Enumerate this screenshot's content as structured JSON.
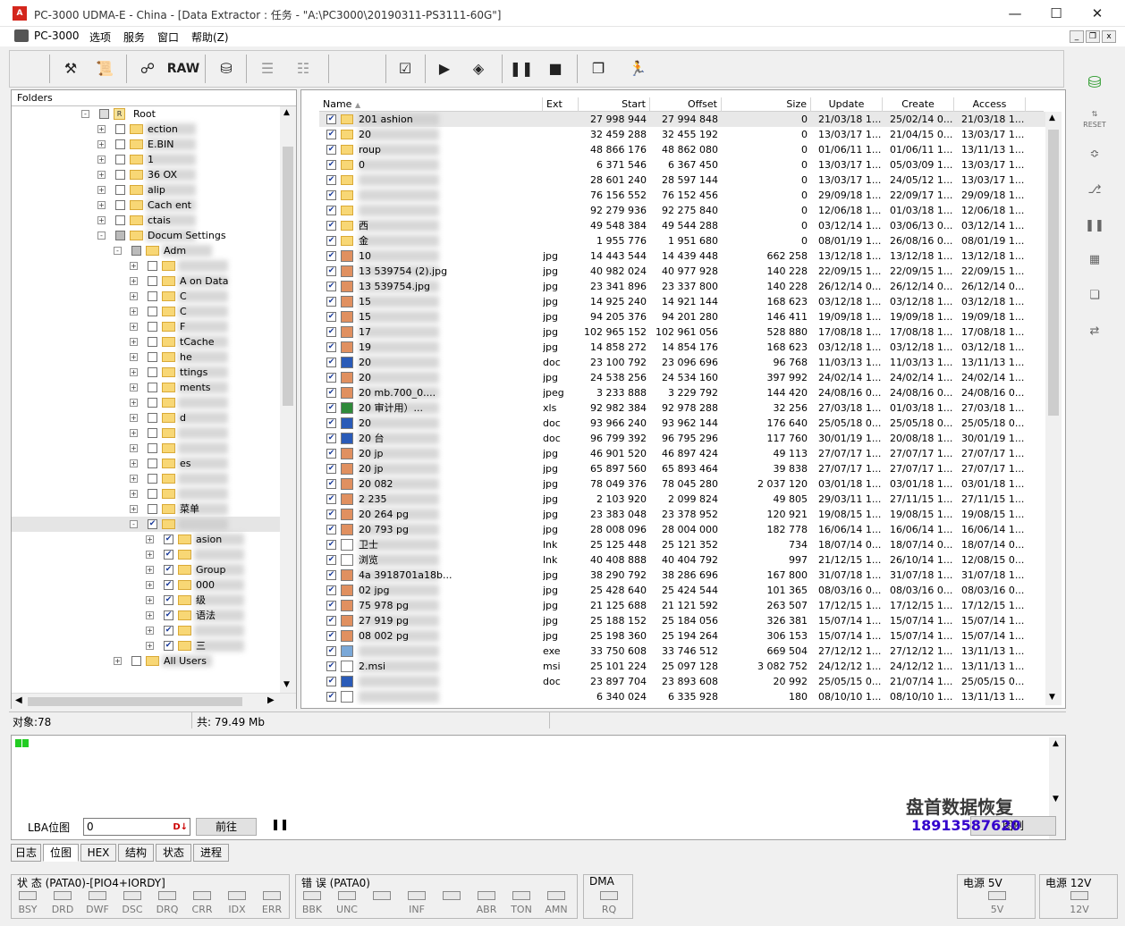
{
  "window": {
    "title": "PC-3000 UDMA-E - China - [Data Extractor : 任务 - \"A:\\PC3000\\20190311-PS3111-60G\"]",
    "app_icon_text": "A"
  },
  "menu": {
    "items": [
      "PC-3000",
      "选项",
      "服务",
      "窗口",
      "帮助(Z)"
    ]
  },
  "toolbar": {
    "raw_label": "RAW"
  },
  "tree": {
    "header": "Folders",
    "root": "Root",
    "rows": [
      {
        "label": "ection",
        "checked": false
      },
      {
        "label": "E.BIN",
        "checked": false
      },
      {
        "label": "1",
        "checked": false
      },
      {
        "label": "36 OX",
        "checked": false
      },
      {
        "label": "alip",
        "checked": false
      },
      {
        "label": "Cach ent",
        "checked": false
      },
      {
        "label": "ctais",
        "checked": false
      },
      {
        "label": "Docum Settings",
        "checked": false
      },
      {
        "label": "Adm",
        "checked": false
      },
      {
        "label": "",
        "checked": false
      },
      {
        "label": "A on Data",
        "checked": false
      },
      {
        "label": "C",
        "checked": false
      },
      {
        "label": "C",
        "checked": false
      },
      {
        "label": "F",
        "checked": false
      },
      {
        "label": "tCache",
        "checked": false
      },
      {
        "label": "he",
        "checked": false
      },
      {
        "label": "ttings",
        "checked": false
      },
      {
        "label": "ments",
        "checked": false
      },
      {
        "label": "",
        "checked": false
      },
      {
        "label": "d",
        "checked": false
      },
      {
        "label": "",
        "checked": false
      },
      {
        "label": "",
        "checked": false
      },
      {
        "label": "es",
        "checked": false
      },
      {
        "label": "",
        "checked": false
      },
      {
        "label": "",
        "checked": false
      },
      {
        "label": "菜单",
        "checked": false
      },
      {
        "label": "",
        "checked": true
      },
      {
        "label": "asion",
        "checked": true
      },
      {
        "label": "",
        "checked": true
      },
      {
        "label": "Group",
        "checked": true
      },
      {
        "label": "000",
        "checked": true
      },
      {
        "label": "级",
        "checked": true
      },
      {
        "label": "语法",
        "checked": true
      },
      {
        "label": "",
        "checked": true
      },
      {
        "label": "三",
        "checked": true
      },
      {
        "label": "All Users",
        "checked": false
      }
    ]
  },
  "files": {
    "columns": [
      "Name",
      "Ext",
      "Start",
      "Offset",
      "Size",
      "Update",
      "Create",
      "Access"
    ],
    "rows": [
      {
        "name": "201 ashion",
        "type": "folder",
        "ext": "",
        "start": "27 998 944",
        "offset": "27 994 848",
        "size": "0",
        "update": "21/03/18 1...",
        "create": "25/02/14 0...",
        "access": "21/03/18 1..."
      },
      {
        "name": "20",
        "type": "folder",
        "ext": "",
        "start": "32 459 288",
        "offset": "32 455 192",
        "size": "0",
        "update": "13/03/17 1...",
        "create": "21/04/15 0...",
        "access": "13/03/17 1..."
      },
      {
        "name": "roup",
        "type": "folder",
        "ext": "",
        "start": "48 866 176",
        "offset": "48 862 080",
        "size": "0",
        "update": "01/06/11 1...",
        "create": "01/06/11 1...",
        "access": "13/11/13 1..."
      },
      {
        "name": "0",
        "type": "folder",
        "ext": "",
        "start": "6 371 546",
        "offset": "6 367 450",
        "size": "0",
        "update": "13/03/17 1...",
        "create": "05/03/09 1...",
        "access": "13/03/17 1..."
      },
      {
        "name": "",
        "type": "folder",
        "ext": "",
        "start": "28 601 240",
        "offset": "28 597 144",
        "size": "0",
        "update": "13/03/17 1...",
        "create": "24/05/12 1...",
        "access": "13/03/17 1..."
      },
      {
        "name": "",
        "type": "folder",
        "ext": "",
        "start": "76 156 552",
        "offset": "76 152 456",
        "size": "0",
        "update": "29/09/18 1...",
        "create": "22/09/17 1...",
        "access": "29/09/18 1..."
      },
      {
        "name": "",
        "type": "folder",
        "ext": "",
        "start": "92 279 936",
        "offset": "92 275 840",
        "size": "0",
        "update": "12/06/18 1...",
        "create": "01/03/18 1...",
        "access": "12/06/18 1..."
      },
      {
        "name": "西",
        "type": "folder",
        "ext": "",
        "start": "49 548 384",
        "offset": "49 544 288",
        "size": "0",
        "update": "03/12/14 1...",
        "create": "03/06/13 0...",
        "access": "03/12/14 1..."
      },
      {
        "name": "金",
        "type": "folder",
        "ext": "",
        "start": "1 955 776",
        "offset": "1 951 680",
        "size": "0",
        "update": "08/01/19 1...",
        "create": "26/08/16 0...",
        "access": "08/01/19 1..."
      },
      {
        "name": "10",
        "type": "jpg",
        "ext": "jpg",
        "start": "14 443 544",
        "offset": "14 439 448",
        "size": "662 258",
        "update": "13/12/18 1...",
        "create": "13/12/18 1...",
        "access": "13/12/18 1..."
      },
      {
        "name": "13 539754 (2).jpg",
        "type": "jpg",
        "ext": "jpg",
        "start": "40 982 024",
        "offset": "40 977 928",
        "size": "140 228",
        "update": "22/09/15 1...",
        "create": "22/09/15 1...",
        "access": "22/09/15 1..."
      },
      {
        "name": "13 539754.jpg",
        "type": "jpg",
        "ext": "jpg",
        "start": "23 341 896",
        "offset": "23 337 800",
        "size": "140 228",
        "update": "26/12/14 0...",
        "create": "26/12/14 0...",
        "access": "26/12/14 0..."
      },
      {
        "name": "15",
        "type": "jpg",
        "ext": "jpg",
        "start": "14 925 240",
        "offset": "14 921 144",
        "size": "168 623",
        "update": "03/12/18 1...",
        "create": "03/12/18 1...",
        "access": "03/12/18 1..."
      },
      {
        "name": "15",
        "type": "jpg",
        "ext": "jpg",
        "start": "94 205 376",
        "offset": "94 201 280",
        "size": "146 411",
        "update": "19/09/18 1...",
        "create": "19/09/18 1...",
        "access": "19/09/18 1..."
      },
      {
        "name": "17",
        "type": "jpg",
        "ext": "jpg",
        "start": "102 965 152",
        "offset": "102 961 056",
        "size": "528 880",
        "update": "17/08/18 1...",
        "create": "17/08/18 1...",
        "access": "17/08/18 1..."
      },
      {
        "name": "19",
        "type": "jpg",
        "ext": "jpg",
        "start": "14 858 272",
        "offset": "14 854 176",
        "size": "168 623",
        "update": "03/12/18 1...",
        "create": "03/12/18 1...",
        "access": "03/12/18 1..."
      },
      {
        "name": "20",
        "type": "doc",
        "ext": "doc",
        "start": "23 100 792",
        "offset": "23 096 696",
        "size": "96 768",
        "update": "11/03/13 1...",
        "create": "11/03/13 1...",
        "access": "13/11/13 1..."
      },
      {
        "name": "20",
        "type": "jpg",
        "ext": "jpg",
        "start": "24 538 256",
        "offset": "24 534 160",
        "size": "397 992",
        "update": "24/02/14 1...",
        "create": "24/02/14 1...",
        "access": "24/02/14 1..."
      },
      {
        "name": "20 mb.700_0....",
        "type": "jpg",
        "ext": "jpeg",
        "start": "3 233 888",
        "offset": "3 229 792",
        "size": "144 420",
        "update": "24/08/16 0...",
        "create": "24/08/16 0...",
        "access": "24/08/16 0..."
      },
      {
        "name": "20 审计用）...",
        "type": "xls",
        "ext": "xls",
        "start": "92 982 384",
        "offset": "92 978 288",
        "size": "32 256",
        "update": "27/03/18 1...",
        "create": "01/03/18 1...",
        "access": "27/03/18 1..."
      },
      {
        "name": "20",
        "type": "doc",
        "ext": "doc",
        "start": "93 966 240",
        "offset": "93 962 144",
        "size": "176 640",
        "update": "25/05/18 0...",
        "create": "25/05/18 0...",
        "access": "25/05/18 0..."
      },
      {
        "name": "20 台",
        "type": "doc",
        "ext": "doc",
        "start": "96 799 392",
        "offset": "96 795 296",
        "size": "117 760",
        "update": "30/01/19 1...",
        "create": "20/08/18 1...",
        "access": "30/01/19 1..."
      },
      {
        "name": "20 jp",
        "type": "jpg",
        "ext": "jpg",
        "start": "46 901 520",
        "offset": "46 897 424",
        "size": "49 113",
        "update": "27/07/17 1...",
        "create": "27/07/17 1...",
        "access": "27/07/17 1..."
      },
      {
        "name": "20 jp",
        "type": "jpg",
        "ext": "jpg",
        "start": "65 897 560",
        "offset": "65 893 464",
        "size": "39 838",
        "update": "27/07/17 1...",
        "create": "27/07/17 1...",
        "access": "27/07/17 1..."
      },
      {
        "name": "20 082",
        "type": "jpg",
        "ext": "jpg",
        "start": "78 049 376",
        "offset": "78 045 280",
        "size": "2 037 120",
        "update": "03/01/18 1...",
        "create": "03/01/18 1...",
        "access": "03/01/18 1..."
      },
      {
        "name": "2 235",
        "type": "jpg",
        "ext": "jpg",
        "start": "2 103 920",
        "offset": "2 099 824",
        "size": "49 805",
        "update": "29/03/11 1...",
        "create": "27/11/15 1...",
        "access": "27/11/15 1..."
      },
      {
        "name": "20 264 pg",
        "type": "jpg",
        "ext": "jpg",
        "start": "23 383 048",
        "offset": "23 378 952",
        "size": "120 921",
        "update": "19/08/15 1...",
        "create": "19/08/15 1...",
        "access": "19/08/15 1..."
      },
      {
        "name": "20 793 pg",
        "type": "jpg",
        "ext": "jpg",
        "start": "28 008 096",
        "offset": "28 004 000",
        "size": "182 778",
        "update": "16/06/14 1...",
        "create": "16/06/14 1...",
        "access": "16/06/14 1..."
      },
      {
        "name": "卫士",
        "type": "lnk",
        "ext": "lnk",
        "start": "25 125 448",
        "offset": "25 121 352",
        "size": "734",
        "update": "18/07/14 0...",
        "create": "18/07/14 0...",
        "access": "18/07/14 0..."
      },
      {
        "name": "浏览",
        "type": "lnk",
        "ext": "lnk",
        "start": "40 408 888",
        "offset": "40 404 792",
        "size": "997",
        "update": "21/12/15 1...",
        "create": "26/10/14 1...",
        "access": "12/08/15 0..."
      },
      {
        "name": "4a 3918701a18b...",
        "type": "jpg",
        "ext": "jpg",
        "start": "38 290 792",
        "offset": "38 286 696",
        "size": "167 800",
        "update": "31/07/18 1...",
        "create": "31/07/18 1...",
        "access": "31/07/18 1..."
      },
      {
        "name": "02 jpg",
        "type": "jpg",
        "ext": "jpg",
        "start": "25 428 640",
        "offset": "25 424 544",
        "size": "101 365",
        "update": "08/03/16 0...",
        "create": "08/03/16 0...",
        "access": "08/03/16 0..."
      },
      {
        "name": "75 978 pg",
        "type": "jpg",
        "ext": "jpg",
        "start": "21 125 688",
        "offset": "21 121 592",
        "size": "263 507",
        "update": "17/12/15 1...",
        "create": "17/12/15 1...",
        "access": "17/12/15 1..."
      },
      {
        "name": "27 919 pg",
        "type": "jpg",
        "ext": "jpg",
        "start": "25 188 152",
        "offset": "25 184 056",
        "size": "326 381",
        "update": "15/07/14 1...",
        "create": "15/07/14 1...",
        "access": "15/07/14 1..."
      },
      {
        "name": "08 002 pg",
        "type": "jpg",
        "ext": "jpg",
        "start": "25 198 360",
        "offset": "25 194 264",
        "size": "306 153",
        "update": "15/07/14 1...",
        "create": "15/07/14 1...",
        "access": "15/07/14 1..."
      },
      {
        "name": "",
        "type": "exe",
        "ext": "exe",
        "start": "33 750 608",
        "offset": "33 746 512",
        "size": "669 504",
        "update": "27/12/12 1...",
        "create": "27/12/12 1...",
        "access": "13/11/13 1..."
      },
      {
        "name": "2.msi",
        "type": "msi",
        "ext": "msi",
        "start": "25 101 224",
        "offset": "25 097 128",
        "size": "3 082 752",
        "update": "24/12/12 1...",
        "create": "24/12/12 1...",
        "access": "13/11/13 1..."
      },
      {
        "name": "",
        "type": "doc",
        "ext": "doc",
        "start": "23 897 704",
        "offset": "23 893 608",
        "size": "20 992",
        "update": "25/05/15 0...",
        "create": "21/07/14 1...",
        "access": "25/05/15 0..."
      },
      {
        "name": "",
        "type": "lnk",
        "ext": "",
        "start": "6 340 024",
        "offset": "6 335 928",
        "size": "180",
        "update": "08/10/10 1...",
        "create": "08/10/10 1...",
        "access": "13/11/13 1..."
      }
    ]
  },
  "status": {
    "objects": "对象:78",
    "total": "共: 79.49 Mb"
  },
  "lba": {
    "label": "LBA位图",
    "value": "0",
    "go_label": "前往",
    "map_label": "图例"
  },
  "watermark": {
    "company": "盘首数据恢复",
    "phone": "18913587620"
  },
  "tabs": [
    "日志",
    "位图",
    "HEX",
    "结构",
    "状态",
    "进程"
  ],
  "active_tab": "位图",
  "status_panel": {
    "label": "状 态 (PATA0)-[PIO4+IORDY]",
    "leds": [
      "BSY",
      "DRD",
      "DWF",
      "DSC",
      "DRQ",
      "CRR",
      "IDX",
      "ERR"
    ]
  },
  "error_panel": {
    "label": "错 误 (PATA0)",
    "leds": [
      "BBK",
      "UNC",
      "",
      "INF",
      "",
      "ABR",
      "TON",
      "AMN"
    ]
  },
  "dma_panel": {
    "label": "DMA",
    "leds": [
      "RQ"
    ]
  },
  "power5": {
    "label": "电源 5V",
    "led": "5V"
  },
  "power12": {
    "label": "电源 12V",
    "led": "12V"
  }
}
